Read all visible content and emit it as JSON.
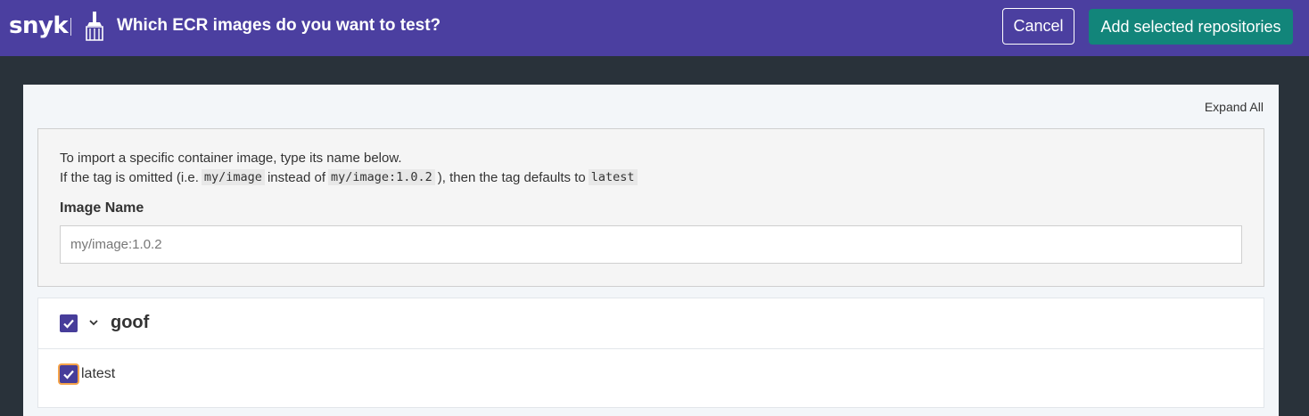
{
  "header": {
    "logo": "snyk",
    "title": "Which ECR images do you want to test?",
    "cancel_label": "Cancel",
    "add_label": "Add selected repositories",
    "icon": "broom-icon",
    "colors": {
      "bar": "#4b3fa0",
      "add_button": "#12857a"
    }
  },
  "panel": {
    "expand_all_label": "Expand All",
    "import": {
      "line1": "To import a specific container image, type its name below.",
      "line2_part1": "If the tag is omitted (i.e.",
      "code1": "my/image",
      "line2_part2": "instead of",
      "code2": "my/image:1.0.2",
      "line2_part3": "), then the tag defaults to",
      "code3": "latest",
      "field_label": "Image Name",
      "field_placeholder": "my/image:1.0.2",
      "field_value": ""
    },
    "repositories": [
      {
        "name": "goof",
        "checked": true,
        "expanded": true,
        "tags": [
          {
            "name": "latest",
            "checked": true
          }
        ]
      }
    ]
  }
}
